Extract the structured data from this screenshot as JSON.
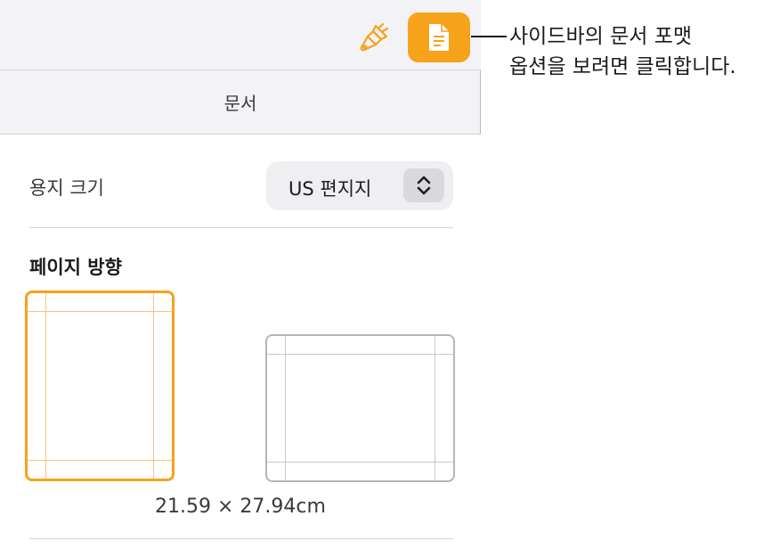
{
  "sidebar": {
    "toolbar": {
      "brush_icon": "paintbrush-icon",
      "document_icon": "document-icon",
      "accent_color": "#f7a21b"
    },
    "tab": {
      "label": "문서"
    },
    "paper_size": {
      "label": "용지 크기",
      "value": "US 편지지"
    },
    "orientation": {
      "title": "페이지 방향",
      "selected": "portrait",
      "dimensions": "21.59 × 27.94cm"
    }
  },
  "callout": {
    "line1": "사이드바의 문서 포맷",
    "line2": "옵션을 보려면 클릭합니다."
  }
}
